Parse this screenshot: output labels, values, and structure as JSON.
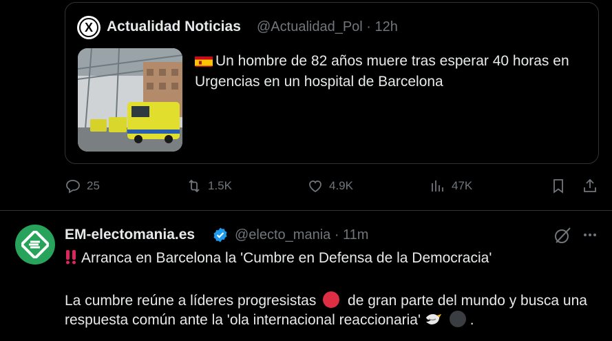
{
  "quote": {
    "avatar_letter": "X",
    "name": "Actualidad Noticias",
    "handle_time": "@Actualidad_Pol · 12h",
    "text": "Un hombre de 82 años muere tras esperar 40 horas en Urgencias en un hospital de Barcelona",
    "flag_icon": "spain-flag-icon",
    "thumbnail": "hospital ambulances photo"
  },
  "actions": {
    "replies": "25",
    "reposts": "1.5K",
    "likes": "4.9K",
    "views": "47K"
  },
  "tweet": {
    "name": "EM-electomania.es",
    "handle_time": "@electo_mania · 11m",
    "line1": "Arranca en Barcelona la 'Cumbre en Defensa de la Democracia'",
    "line2_a": "La cumbre reúne a líderes progresistas",
    "line2_b": "de gran parte del mundo y busca una respuesta común ante la 'ola internacional reaccionaria'",
    "line2_end": ".",
    "avatar_color": "#27a35b",
    "verified_color": "#1d9bf0"
  }
}
